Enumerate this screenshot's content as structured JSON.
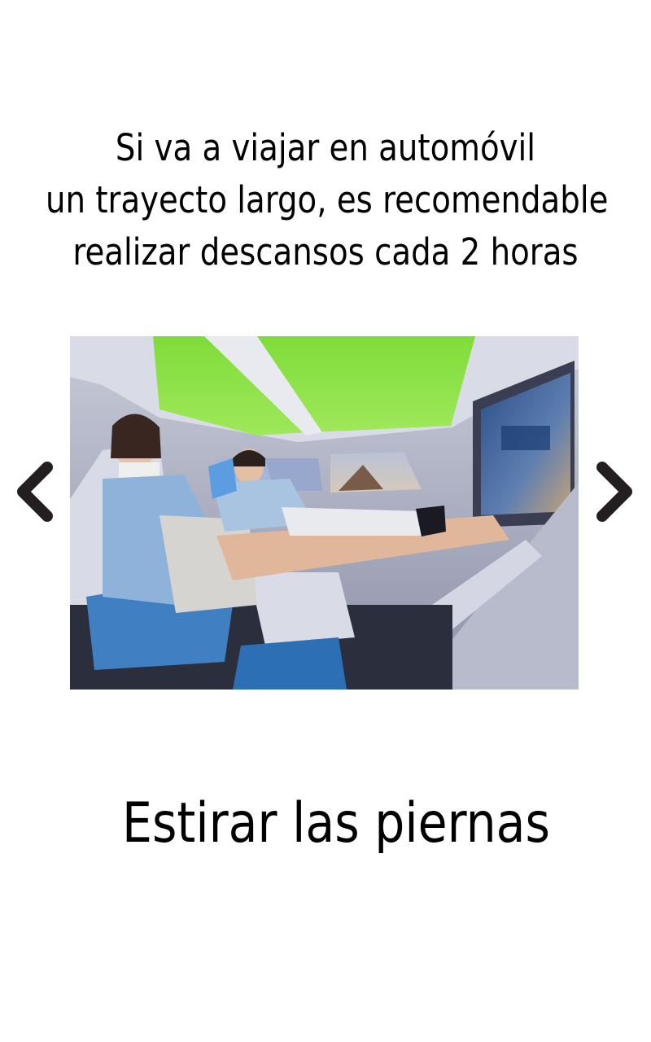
{
  "question": {
    "lines": [
      "Si va a viajar en automóvil",
      "un trayecto largo, es recomendable",
      "realizar descansos cada 2 horas"
    ]
  },
  "image": {
    "alt": "Dos pasajeros descansando en el interior de un automóvil con asientos reclinados y techo verde iluminado"
  },
  "navigation": {
    "prev_icon": "chevron-left-icon",
    "next_icon": "chevron-right-icon"
  },
  "answer": {
    "label": "Estirar las piernas"
  },
  "colors": {
    "background": "#ffffff",
    "text": "#000000",
    "nav_icon": "#231f20"
  }
}
